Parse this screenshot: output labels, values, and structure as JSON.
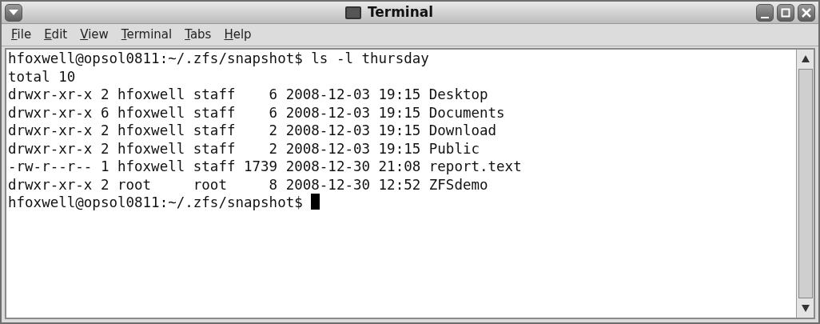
{
  "window": {
    "title": "Terminal"
  },
  "menu": [
    "File",
    "Edit",
    "View",
    "Terminal",
    "Tabs",
    "Help"
  ],
  "terminal": {
    "lines": [
      "hfoxwell@opsol0811:~/.zfs/snapshot$ ls -l thursday",
      "total 10",
      "drwxr-xr-x 2 hfoxwell staff    6 2008-12-03 19:15 Desktop",
      "drwxr-xr-x 6 hfoxwell staff    6 2008-12-03 19:15 Documents",
      "drwxr-xr-x 2 hfoxwell staff    2 2008-12-03 19:15 Download",
      "drwxr-xr-x 2 hfoxwell staff    2 2008-12-03 19:15 Public",
      "-rw-r--r-- 1 hfoxwell staff 1739 2008-12-30 21:08 report.text",
      "drwxr-xr-x 2 root     root     8 2008-12-30 12:52 ZFSdemo",
      "hfoxwell@opsol0811:~/.zfs/snapshot$ "
    ]
  }
}
